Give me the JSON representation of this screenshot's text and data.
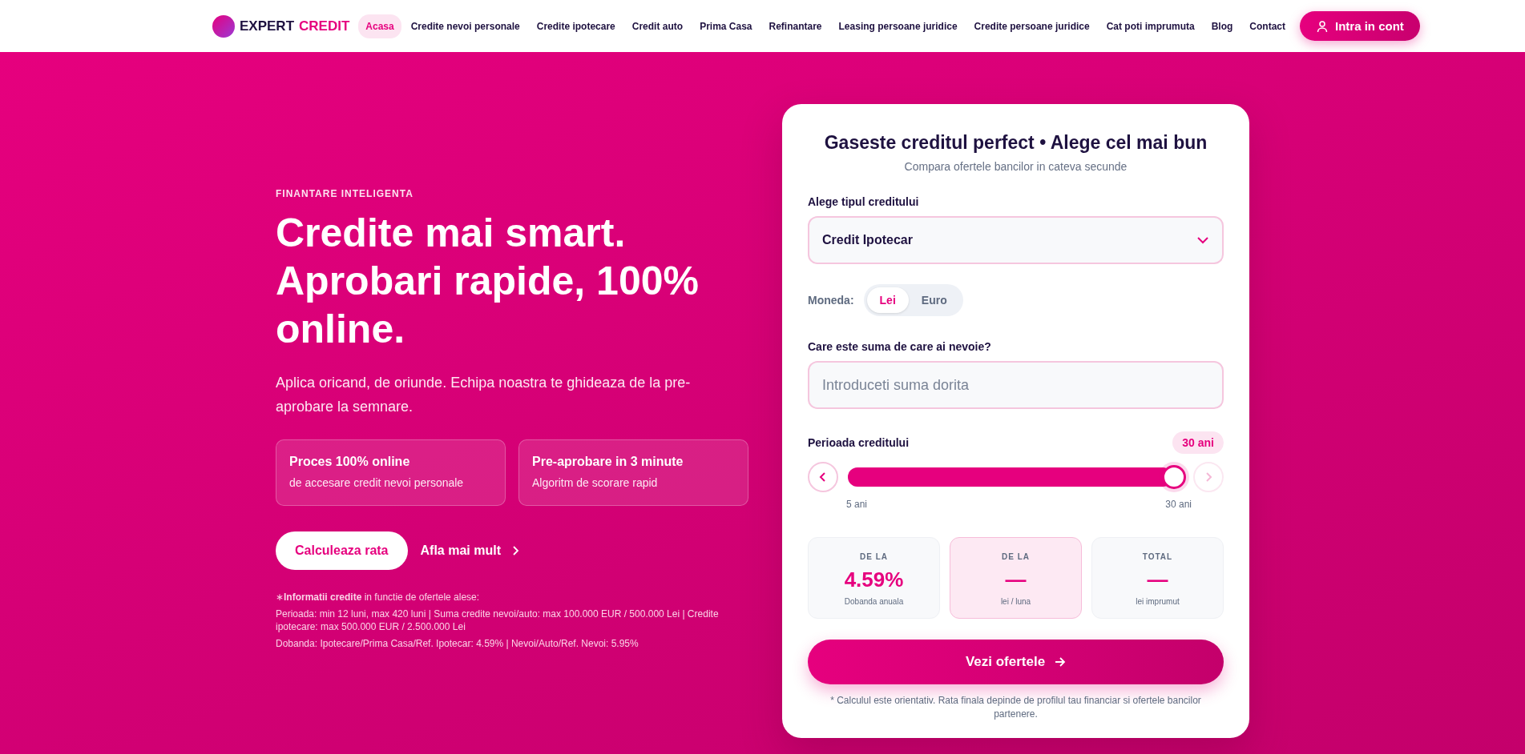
{
  "header": {
    "logo": {
      "word_1": "EXPERT",
      "word_2": "CREDIT"
    },
    "nav": [
      {
        "label": "Acasa",
        "selected": true
      },
      {
        "label": "Credite nevoi personale",
        "selected": false
      },
      {
        "label": "Credite ipotecare",
        "selected": false
      },
      {
        "label": "Credit auto",
        "selected": false
      },
      {
        "label": "Prima Casa",
        "selected": false
      },
      {
        "label": "Refinantare",
        "selected": false
      },
      {
        "label": "Leasing persoane juridice",
        "selected": false
      },
      {
        "label": "Credite persoane juridice",
        "selected": false
      },
      {
        "label": "Cat poti imprumuta",
        "selected": false
      },
      {
        "label": "Blog",
        "selected": false
      },
      {
        "label": "Contact",
        "selected": false
      }
    ],
    "login_button": "Intra in cont"
  },
  "hero": {
    "eyebrow": "FINANTARE INTELIGENTA",
    "heading": "Credite mai smart. Aprobari rapide, 100% online.",
    "lead": "Aplica oricand, de oriunde. Echipa noastra te ghideaza de la pre-aprobare la semnare.",
    "features": [
      {
        "title": "Proces 100% online",
        "text": "de accesare credit nevoi personale"
      },
      {
        "title": "Pre-aprobare in 3 minute",
        "text": "Algoritm de scorare rapid"
      }
    ],
    "primary_button": "Calculeaza rata",
    "link": "Afla mai mult",
    "notes": [
      "∗**Informatii credite** in functie de ofertele alese:",
      "Perioada: min 12 luni, max 420 luni | Suma credite nevoi/auto: max 100.000 EUR / 500.000 Lei | Credite ipotecare: max 500.000 EUR / 2.500.000 Lei",
      "Dobanda: Ipotecare/Prima Casa/Ref. Ipotecar: 4.59% | Nevoi/Auto/Ref. Nevoi: 5.95%"
    ]
  },
  "calculator": {
    "title": "Gaseste creditul perfect • Alege cel mai bun",
    "subtitle": "Compara ofertele bancilor in cateva secunde",
    "type_label": "Alege tipul creditului",
    "type_value": "Credit Ipotecar",
    "currency_label": "Moneda:",
    "currencies": [
      {
        "label": "Lei",
        "selected": true
      },
      {
        "label": "Euro",
        "selected": false
      }
    ],
    "amount_label": "Care este suma de care ai nevoie?",
    "amount": {
      "placeholder": "Introduceti suma dorita"
    },
    "period_label": "Perioada creditului",
    "period_value": "30 ani",
    "period_slider": {
      "level": 1,
      "min_label": "5 ani",
      "max_label": "30 ani",
      "prev_disabled": false,
      "next_disabled": true
    },
    "stats": [
      {
        "label": "DE LA",
        "value": "4.59%",
        "caption": "Dobanda anuala",
        "highlighted": false
      },
      {
        "label": "DE LA",
        "value": "—",
        "caption": "lei / luna",
        "highlighted": true
      },
      {
        "label": "TOTAL",
        "value": "—",
        "caption": "lei imprumut",
        "highlighted": false
      }
    ],
    "submit_button": "Vezi ofertele",
    "disclaimer": "* Calculul este orientativ. Rata finala depinde de profilul tau financiar si ofertele bancilor partenere."
  }
}
